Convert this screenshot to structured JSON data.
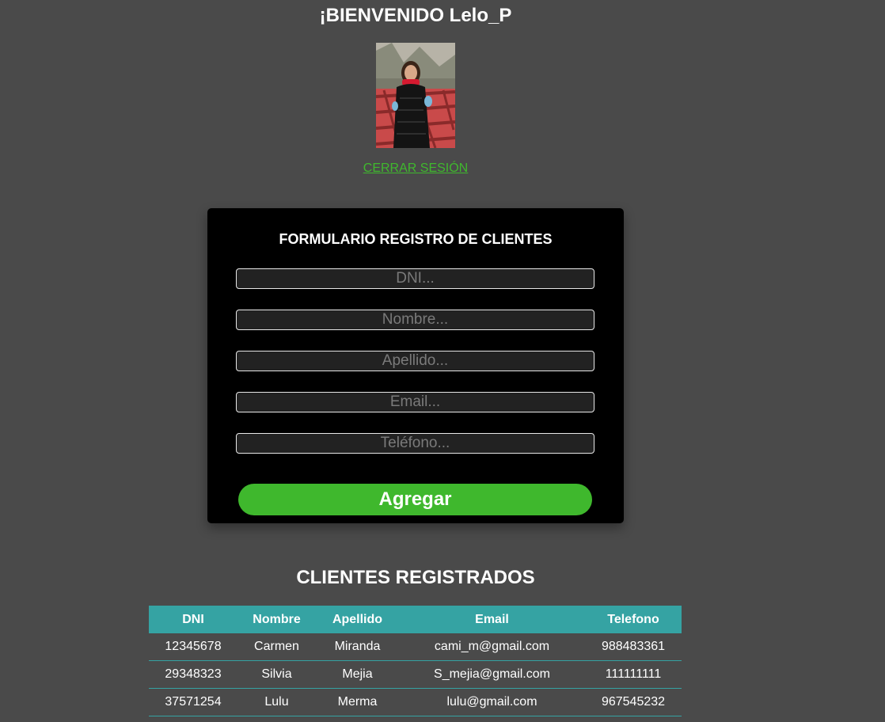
{
  "header": {
    "welcome": "¡BIENVENIDO Lelo_P",
    "logout_label": "CERRAR SESIÓN"
  },
  "form": {
    "title": "FORMULARIO REGISTRO DE CLIENTES",
    "fields": {
      "dni": {
        "placeholder": "DNI...",
        "value": ""
      },
      "nombre": {
        "placeholder": "Nombre...",
        "value": ""
      },
      "apellido": {
        "placeholder": "Apellido...",
        "value": ""
      },
      "email": {
        "placeholder": "Email...",
        "value": ""
      },
      "telefono": {
        "placeholder": "Teléfono...",
        "value": ""
      }
    },
    "submit_label": "Agregar"
  },
  "clients": {
    "title": "CLIENTES REGISTRADOS",
    "columns": [
      "DNI",
      "Nombre",
      "Apellido",
      "Email",
      "Telefono"
    ],
    "rows": [
      [
        "12345678",
        "Carmen",
        "Miranda",
        "cami_m@gmail.com",
        "988483361"
      ],
      [
        "29348323",
        "Silvia",
        "Mejia",
        "S_mejia@gmail.com",
        "111111111"
      ],
      [
        "37571254",
        "Lulu",
        "Merma",
        "lulu@gmail.com",
        "967545232"
      ]
    ]
  },
  "colors": {
    "background": "#4a4a4a",
    "accent_green": "#3fb82d",
    "table_header": "#35a3a3",
    "card": "#000000"
  }
}
